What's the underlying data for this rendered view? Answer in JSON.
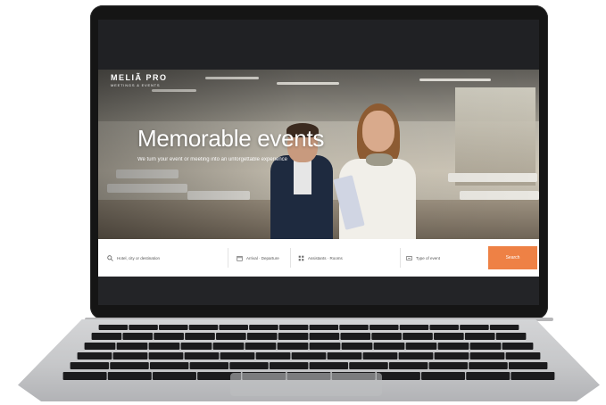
{
  "brand": {
    "name": "MELIÃ PRO",
    "tagline": "MEETINGS & EVENTS"
  },
  "hero": {
    "title": "Memorable events",
    "subtitle": "We turn your event or meeting into an unforgettable experience"
  },
  "search": {
    "destination_placeholder": "Hotel, city or destination",
    "dates_label": "Arrival · Departure",
    "attendees_label": "Assistants · Rooms",
    "event_type_label": "Type of event",
    "button_label": "Search"
  },
  "colors": {
    "accent": "#ee8145",
    "device_bezel": "#151515",
    "device_body": "#c6c7c9"
  },
  "icons": {
    "search": "search-icon",
    "calendar": "calendar-icon",
    "attendees": "attendees-icon",
    "event_type": "event-type-icon"
  }
}
